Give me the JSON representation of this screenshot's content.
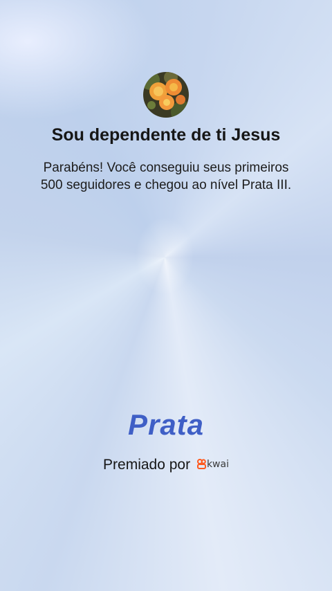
{
  "profile": {
    "avatar_icon": "flower-photo-avatar",
    "name": "Sou dependente de ti Jesus"
  },
  "message": "Parabéns! Você conseguiu seus primeiros 500 seguidores e chegou ao nível Prata III.",
  "level": {
    "label": "Prata",
    "color": "#3f5fc6"
  },
  "award": {
    "prefix": "Premiado por",
    "brand": "kwai",
    "brand_icon": "kwai-logo-icon",
    "brand_color": "#ff5a1f"
  }
}
